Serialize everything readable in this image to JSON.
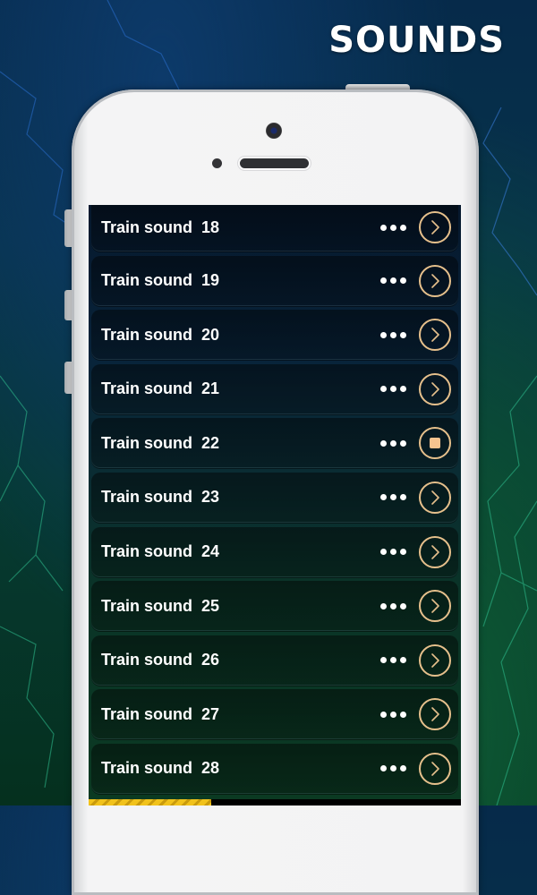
{
  "header": {
    "title": "SOUNDS"
  },
  "colors": {
    "accent_ring": "#e6c08c",
    "stop_square": "#f6c38f",
    "progress_fill": "#f1c21b",
    "text": "#ffffff"
  },
  "sounds": [
    {
      "label": "Train sound  18",
      "state": "idle",
      "more_icon": "more-dots-icon",
      "action_icon": "chevron-right-icon"
    },
    {
      "label": "Train sound  19",
      "state": "idle",
      "more_icon": "more-dots-icon",
      "action_icon": "chevron-right-icon"
    },
    {
      "label": "Train sound  20",
      "state": "idle",
      "more_icon": "more-dots-icon",
      "action_icon": "chevron-right-icon"
    },
    {
      "label": "Train sound  21",
      "state": "idle",
      "more_icon": "more-dots-icon",
      "action_icon": "chevron-right-icon"
    },
    {
      "label": "Train sound  22",
      "state": "playing",
      "more_icon": "more-dots-icon",
      "action_icon": "stop-icon"
    },
    {
      "label": "Train sound  23",
      "state": "idle",
      "more_icon": "more-dots-icon",
      "action_icon": "chevron-right-icon"
    },
    {
      "label": "Train sound  24",
      "state": "idle",
      "more_icon": "more-dots-icon",
      "action_icon": "chevron-right-icon"
    },
    {
      "label": "Train sound  25",
      "state": "idle",
      "more_icon": "more-dots-icon",
      "action_icon": "chevron-right-icon"
    },
    {
      "label": "Train sound  26",
      "state": "idle",
      "more_icon": "more-dots-icon",
      "action_icon": "chevron-right-icon"
    },
    {
      "label": "Train sound  27",
      "state": "idle",
      "more_icon": "more-dots-icon",
      "action_icon": "chevron-right-icon"
    },
    {
      "label": "Train sound  28",
      "state": "idle",
      "more_icon": "more-dots-icon",
      "action_icon": "chevron-right-icon"
    }
  ],
  "playback": {
    "progress_fraction": 0.33
  }
}
